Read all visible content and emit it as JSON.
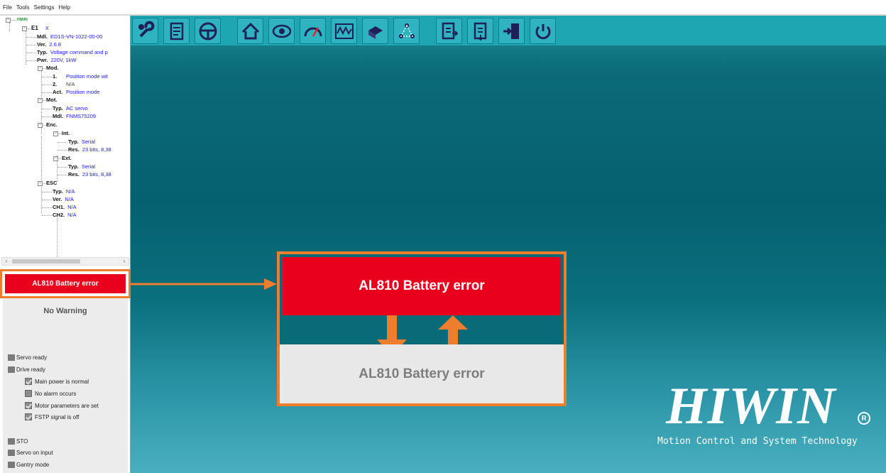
{
  "menu": [
    "File",
    "Tools",
    "Settings",
    "Help"
  ],
  "tree": {
    "root": "HIWIN",
    "device": {
      "name": "E1",
      "axis": "X"
    },
    "info": [
      {
        "key": "Mdl.",
        "value": "ED1S-VN-1022-00-00"
      },
      {
        "key": "Ver.",
        "value": "2.6.8"
      },
      {
        "key": "Typ.",
        "value": "Voltage command and p"
      },
      {
        "key": "Pwr.",
        "value": "220V, 1kW"
      }
    ],
    "mod": {
      "label": "Mod.",
      "items": [
        {
          "key": "1.",
          "value": "Position mode wit"
        },
        {
          "key": "2.",
          "value": "N/A"
        },
        {
          "key": "Act.",
          "value": "Position mode"
        }
      ]
    },
    "mot": {
      "label": "Mot.",
      "items": [
        {
          "key": "Typ.",
          "value": "AC servo"
        },
        {
          "key": "Mdl.",
          "value": "FNMS75209"
        }
      ]
    },
    "enc": {
      "label": "Enc.",
      "int": {
        "label": "Int.",
        "items": [
          {
            "key": "Typ.",
            "value": "Serial"
          },
          {
            "key": "Res.",
            "value": "23 bits, 8,38"
          }
        ]
      },
      "ext": {
        "label": "Ext.",
        "items": [
          {
            "key": "Typ.",
            "value": "Serial"
          },
          {
            "key": "Res.",
            "value": "23 bits, 8,38"
          }
        ]
      }
    },
    "esc": {
      "label": "ESC",
      "items": [
        {
          "key": "Typ.",
          "value": "N/A"
        },
        {
          "key": "Ver.",
          "value": "N/A"
        },
        {
          "key": "CH1.",
          "value": "N/A"
        },
        {
          "key": "CH2.",
          "value": "N/A"
        }
      ]
    }
  },
  "alarm": {
    "text": "AL810  Battery error",
    "color": "#e8001c"
  },
  "warning": {
    "text": "No Warning"
  },
  "status": {
    "servo_ready": "Servo ready",
    "drive_ready": "Drive ready",
    "checks": [
      {
        "label": "Main power is normal",
        "checked": true
      },
      {
        "label": "No alarm occurs",
        "checked": false
      },
      {
        "label": "Motor parameters are set",
        "checked": true
      },
      {
        "label": "FSTP signal is off",
        "checked": true
      }
    ],
    "sto": "STO",
    "servo_on_input": "Servo on input",
    "gantry_mode": "Gantry mode"
  },
  "toolbar_icons": [
    "configuration-icon",
    "parameter-list-icon",
    "steering-wheel-icon",
    "home-icon",
    "eye-icon",
    "speedometer-icon",
    "waveform-icon",
    "motor-icon",
    "network-icon",
    "export-document-icon",
    "import-document-icon",
    "save-to-drive-icon",
    "power-icon"
  ],
  "callout": {
    "active_text": "AL810  Battery error",
    "inactive_text": "AL810  Battery error"
  },
  "logo": {
    "brand": "HIWIN",
    "reg": "R",
    "tagline": "Motion Control and System Technology"
  },
  "colors": {
    "accent": "#ee7d2d",
    "alarm_red": "#e8001c",
    "teal": "#0a6b78",
    "toolbar": "#1ea7b3"
  }
}
